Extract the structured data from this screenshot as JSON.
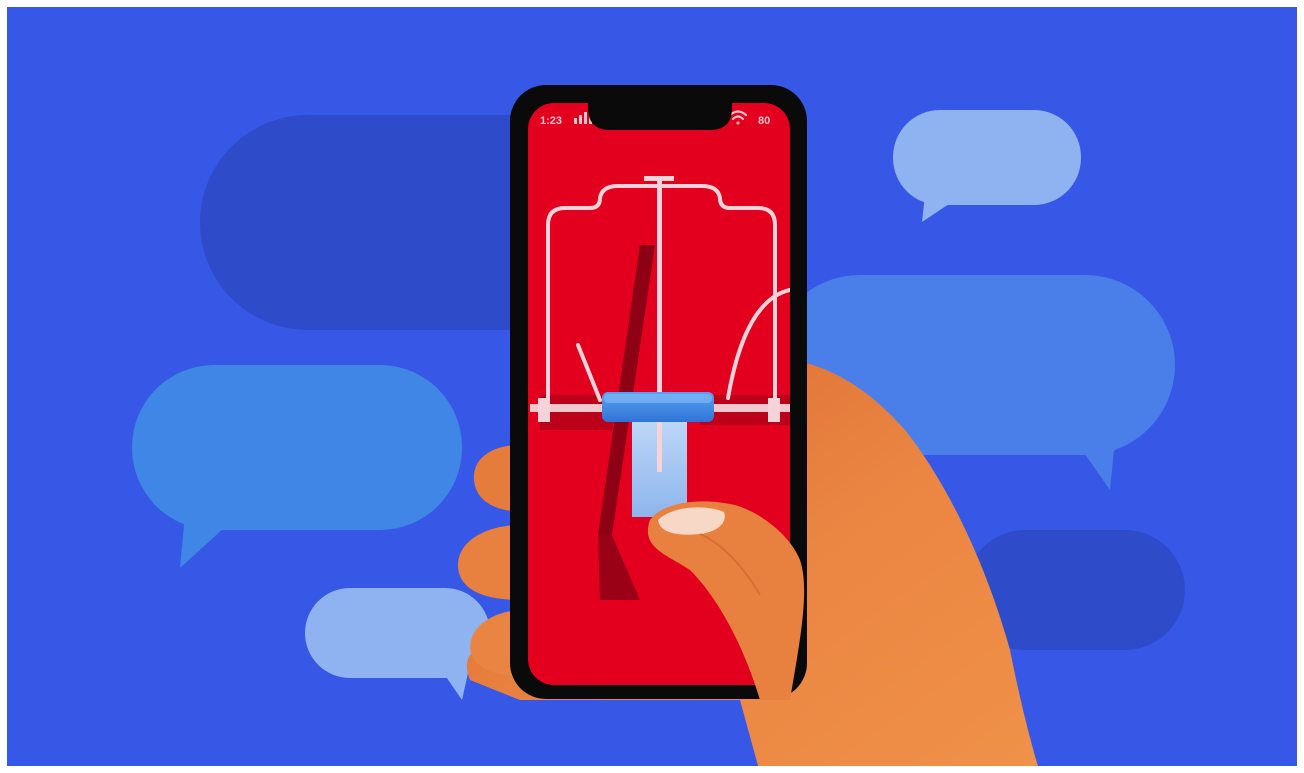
{
  "illustration": {
    "subject": "hand-holding-smartphone-with-chat-bubbles",
    "colors": {
      "background": "#3758e6",
      "frame_border": "#ffffff",
      "screen": "#e3001f",
      "phone_body": "#0a0a0a",
      "hand": "#e9803f",
      "bubble_dark": "#2e4bc9",
      "bubble_mid": "#4a7ee9",
      "bubble_light": "#8fb2f1",
      "bubble_sky": "#3f86e6",
      "product_lines": "#f5d3d8",
      "handle": "#3f8ee8"
    },
    "phone": {
      "status_time": "1:23",
      "status_battery": "80"
    }
  }
}
